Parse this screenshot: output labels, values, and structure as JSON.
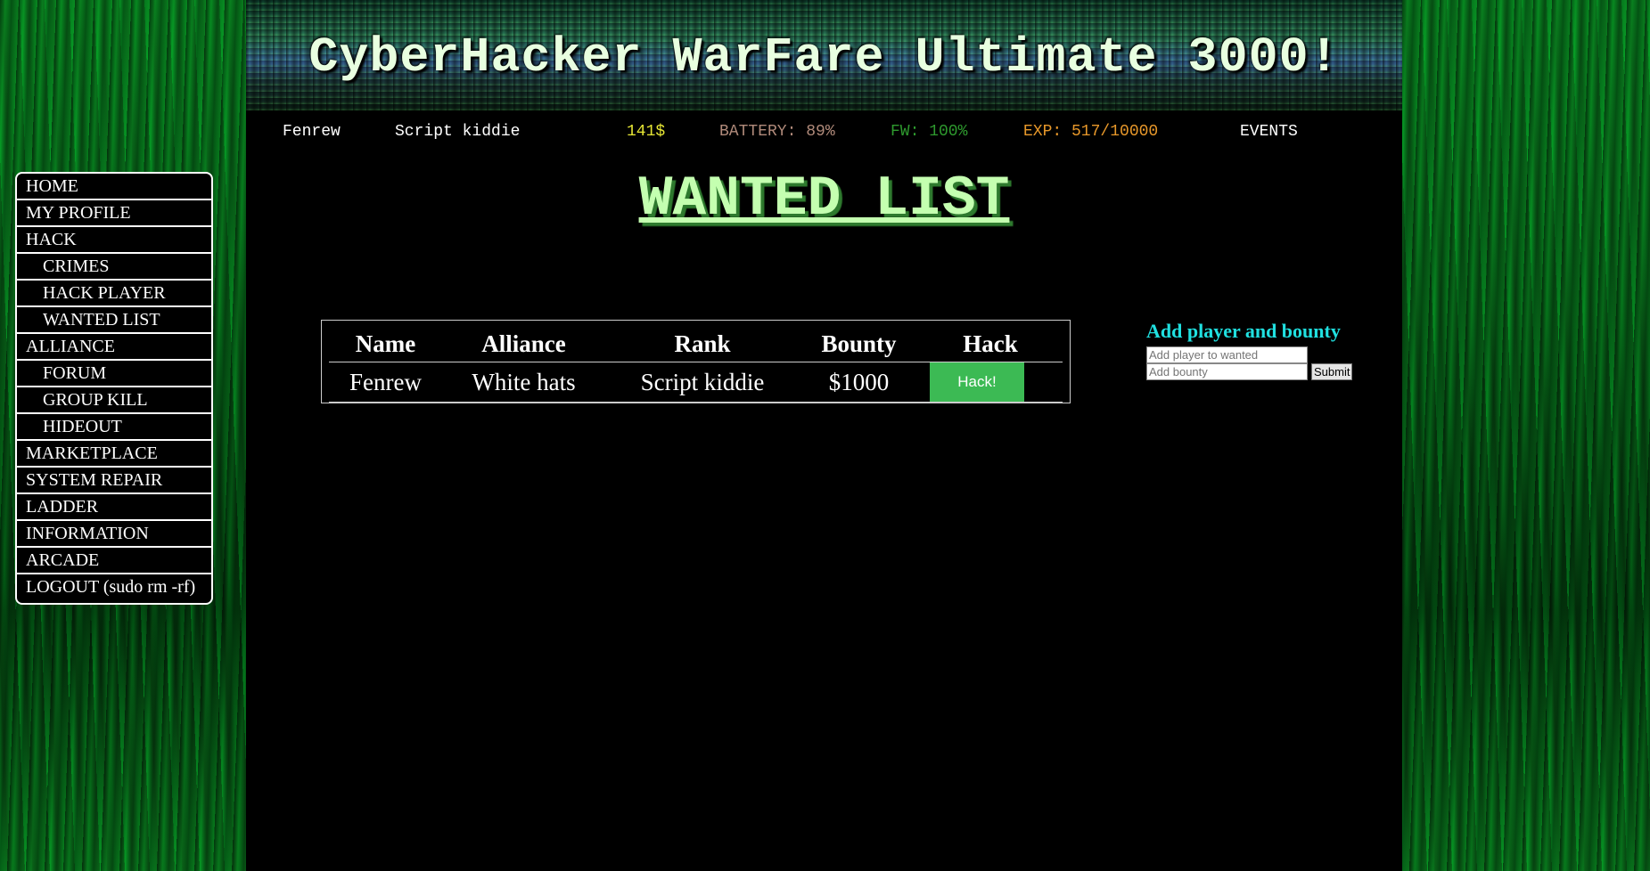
{
  "header": {
    "title": "CyberHacker WarFare Ultimate 3000!"
  },
  "status": {
    "username": "Fenrew",
    "rank": "Script kiddie",
    "money": "141$",
    "battery": "BATTERY: 89%",
    "firewall": "FW: 100%",
    "exp": "EXP: 517/10000",
    "events": "EVENTS"
  },
  "colors": {
    "money": "#e6e635",
    "battery": "#b08a7a",
    "firewall": "#2e9a2e",
    "exp": "#e8982a",
    "title": "#c4ffb0",
    "hack_button": "#3cba54",
    "form_heading": "#20e0e0"
  },
  "nav": {
    "items": [
      {
        "label": "HOME"
      },
      {
        "label": "MY PROFILE"
      },
      {
        "label": "HACK"
      },
      {
        "label": "CRIMES"
      },
      {
        "label": "HACK PLAYER"
      },
      {
        "label": "WANTED LIST"
      },
      {
        "label": "ALLIANCE"
      },
      {
        "label": "FORUM"
      },
      {
        "label": "GROUP KILL"
      },
      {
        "label": "HIDEOUT"
      },
      {
        "label": "MARKETPLACE"
      },
      {
        "label": "SYSTEM REPAIR"
      },
      {
        "label": "LADDER"
      },
      {
        "label": "INFORMATION"
      },
      {
        "label": "ARCADE"
      },
      {
        "label": "LOGOUT (sudo rm -rf)"
      }
    ]
  },
  "page": {
    "title": "WANTED LIST"
  },
  "wanted_table": {
    "headers": [
      "Name",
      "Alliance",
      "Rank",
      "Bounty",
      "Hack"
    ],
    "rows": [
      {
        "name": "Fenrew",
        "alliance": "White hats",
        "rank": "Script kiddie",
        "bounty": "$1000",
        "action": "Hack!"
      }
    ]
  },
  "bounty_form": {
    "heading": "Add player and bounty",
    "player_placeholder": "Add player to wanted",
    "bounty_placeholder": "Add bounty",
    "submit_label": "Submit"
  }
}
